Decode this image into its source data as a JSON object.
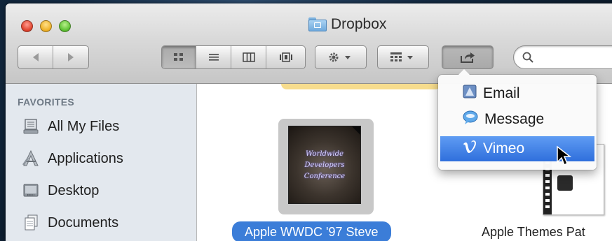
{
  "window": {
    "title": "Dropbox"
  },
  "toolbar": {
    "back_icon": "back-arrow-icon",
    "forward_icon": "forward-arrow-icon",
    "view_modes": [
      "icon-view",
      "list-view",
      "column-view",
      "coverflow-view"
    ],
    "active_view": "icon-view",
    "action_icon": "gear-icon",
    "arrange_icon": "arrange-icon",
    "share_icon": "share-icon",
    "search": {
      "placeholder": "",
      "value": ""
    }
  },
  "sidebar": {
    "heading": "FAVORITES",
    "items": [
      {
        "label": "All My Files",
        "icon": "all-my-files-icon"
      },
      {
        "label": "Applications",
        "icon": "applications-icon"
      },
      {
        "label": "Desktop",
        "icon": "desktop-icon"
      },
      {
        "label": "Documents",
        "icon": "documents-icon"
      }
    ]
  },
  "content": {
    "files": [
      {
        "name": "Apple WWDC '97 Steve",
        "selected": true,
        "thumb_lines": [
          "Worldwide",
          "Developers",
          "Conference"
        ]
      },
      {
        "name": "Apple Themes Pat",
        "selected": false
      }
    ]
  },
  "share_menu": {
    "items": [
      {
        "label": "Email",
        "icon": "email-icon"
      },
      {
        "label": "Message",
        "icon": "message-icon"
      },
      {
        "label": "Vimeo",
        "icon": "vimeo-icon",
        "highlighted": true
      }
    ]
  },
  "colors": {
    "selection": "#3b7dd8",
    "menu_highlight": "#2f6fdc",
    "sidebar_bg": "#e3e8ee"
  }
}
